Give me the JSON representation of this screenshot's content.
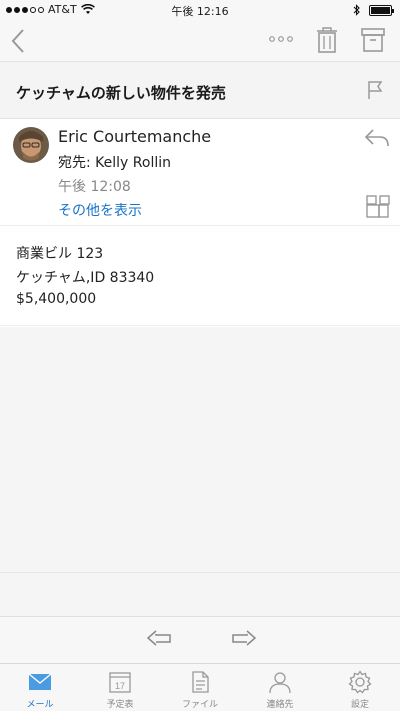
{
  "status_bar": {
    "carrier": "AT&T",
    "time": "午後 12:16"
  },
  "nav": {
    "back_icon": "chevron-left-icon",
    "more_icon": "more-icon",
    "delete_icon": "trash-icon",
    "archive_icon": "archive-icon"
  },
  "message": {
    "subject": "ケッチャムの新しい物件を発売",
    "sender": "Eric Courtemanche",
    "to_line": "宛先: Kelly Rollin",
    "time": "午後 12:08",
    "show_more": "その他を表示",
    "body_lines": [
      "商業ビル 123",
      "ケッチャム,ID 83340",
      "$5,400,000"
    ]
  },
  "tabs": [
    {
      "label": "メール",
      "icon": "mail-icon",
      "active": true
    },
    {
      "label": "予定表",
      "icon": "calendar-icon",
      "calendar_day": "17",
      "active": false
    },
    {
      "label": "ファイル",
      "icon": "file-icon",
      "active": false
    },
    {
      "label": "連絡先",
      "icon": "contacts-icon",
      "active": false
    },
    {
      "label": "設定",
      "icon": "settings-icon",
      "active": false
    }
  ],
  "colors": {
    "accent": "#1a73c8",
    "icon_gray": "#999999"
  }
}
